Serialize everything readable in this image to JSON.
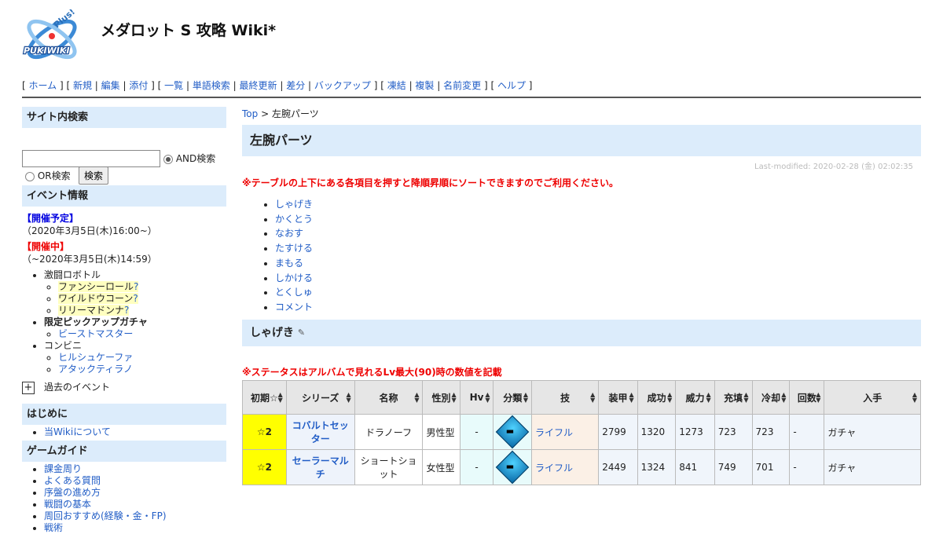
{
  "header": {
    "logo_text": "PUKIWIKI",
    "logo_plus": "Plus!",
    "title": "メダロット S 攻略 Wiki*"
  },
  "nav": [
    [
      "ホーム"
    ],
    [
      "新規",
      "編集",
      "添付"
    ],
    [
      "一覧",
      "単語検索",
      "最終更新",
      "差分",
      "バックアップ"
    ],
    [
      "凍結",
      "複製",
      "名前変更"
    ],
    [
      "ヘルプ"
    ]
  ],
  "sidebar": {
    "search_head": "サイト内検索",
    "and_label": "AND検索",
    "or_label": "OR検索",
    "search_button": "検索",
    "event_head": "イベント情報",
    "upcoming_label": "【開催予定】",
    "upcoming_date": "（2020年3月5日(木)16:00~）",
    "ongoing_label": "【開催中】",
    "ongoing_date": "（~2020年3月5日(木)14:59）",
    "robattle": "激闘ロボトル",
    "robattle_items": [
      "ファンシーロール",
      "ワイルドウコーン",
      "リリーマドンナ"
    ],
    "gacha": "限定ピックアップガチャ",
    "gacha_items": [
      "ビーストマスター"
    ],
    "convenience": "コンビニ",
    "convenience_items": [
      "ヒルシュケーファ",
      "アタックティラノ"
    ],
    "past_events": "過去のイベント",
    "intro_head": "はじめに",
    "intro_items": [
      "当Wikiについて"
    ],
    "guide_head": "ゲームガイド",
    "guide_items": [
      "課金周り",
      "よくある質問",
      "序盤の進め方",
      "戦闘の基本",
      "周回おすすめ(経験・金・FP)",
      "戦術"
    ]
  },
  "main": {
    "breadcrumb_top": "Top",
    "breadcrumb_sep": " > ",
    "breadcrumb_current": "左腕パーツ",
    "page_title": "左腕パーツ",
    "last_modified": "Last-modified: 2020-02-28 (金) 02:02:35",
    "sort_notice": "※テーブルの上下にある各項目を押すと降順昇順にソートできますのでご利用ください。",
    "toc": [
      "しゃげき",
      "かくとう",
      "なおす",
      "たすける",
      "まもる",
      "しかける",
      "とくしゅ",
      "コメント"
    ],
    "section_title": "しゃげき",
    "status_notice": "※ステータスはアルバムで見れるLv最大(90)時の数値を記載",
    "table_headers": [
      "初期☆",
      "シリーズ",
      "名称",
      "性別",
      "Hv",
      "分類",
      "技",
      "装甲",
      "成功",
      "威力",
      "充填",
      "冷却",
      "回数",
      "入手"
    ],
    "rows": [
      {
        "init": "☆2",
        "series": "コバルトセッター",
        "name": "ドラノーフ",
        "gender": "男性型",
        "hv": "-",
        "skill": "ライフル",
        "armor": "2799",
        "success": "1320",
        "power": "1273",
        "charge": "723",
        "cool": "723",
        "count": "-",
        "obtain": "ガチャ"
      },
      {
        "init": "☆2",
        "series": "セーラーマルチ",
        "name": "ショートショット",
        "gender": "女性型",
        "hv": "-",
        "skill": "ライフル",
        "armor": "2449",
        "success": "1324",
        "power": "841",
        "charge": "749",
        "cool": "701",
        "count": "-",
        "obtain": "ガチャ"
      }
    ]
  }
}
